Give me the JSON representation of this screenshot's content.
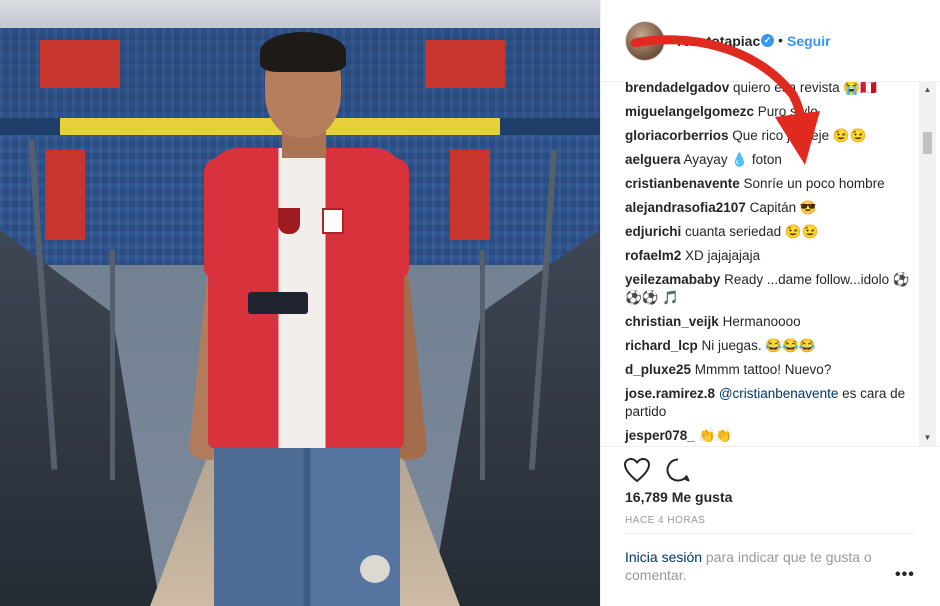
{
  "post": {
    "username": "renatotapiac",
    "follow_label": "Seguir",
    "separator": "•",
    "verified_mark": "✓"
  },
  "comments": [
    {
      "user": "brendadelgadov",
      "text": " quiero esa revista 😭🇵🇪"
    },
    {
      "user": "miguelangelgomezc",
      "text": " Puro stylo"
    },
    {
      "user": "gloriacorberrios",
      "text": " Que rico jejejeje 😉😉"
    },
    {
      "user": "aelguera",
      "text": " Ayayay 💧 foton"
    },
    {
      "user": "cristianbenavente",
      "text": " Sonríe un poco hombre"
    },
    {
      "user": "alejandrasofia2107",
      "text": " Capitán 😎"
    },
    {
      "user": "edjurichi",
      "text": " cuanta seriedad 😉😉"
    },
    {
      "user": "rofaelm2",
      "text": " XD jajajajaja"
    },
    {
      "user": "yeilezamababy",
      "text": " Ready ...dame follow...idolo ⚽⚽⚽ 🎵"
    },
    {
      "user": "christian_veijk",
      "text": " Hermanoooo"
    },
    {
      "user": "richard_lcp",
      "text": " Ni juegas. 😂😂😂"
    },
    {
      "user": "d_pluxe25",
      "text": " Mmmm tattoo! Nuevo?"
    },
    {
      "user": "jose.ramirez.8",
      "mention": " @cristianbenavente",
      "text": " es cara de partido"
    },
    {
      "user": "jesper078_",
      "text": " 👏👏"
    }
  ],
  "actions": {
    "likes": "16,789 Me gusta",
    "time": "HACE 4 HORAS",
    "login_link": "Inicia sesión",
    "login_text": " para indicar que te gusta o comentar.",
    "more": "•••"
  },
  "icons": {
    "like": "heart-icon",
    "comment": "comment-bubble-icon",
    "verified": "verified-badge-icon",
    "more": "more-options-icon",
    "arrow": "red-arrow-annotation"
  },
  "colors": {
    "link_blue": "#3897f0",
    "mention_blue": "#003569",
    "arrow_red": "#e02a20",
    "text": "#262626",
    "muted": "#999999"
  }
}
